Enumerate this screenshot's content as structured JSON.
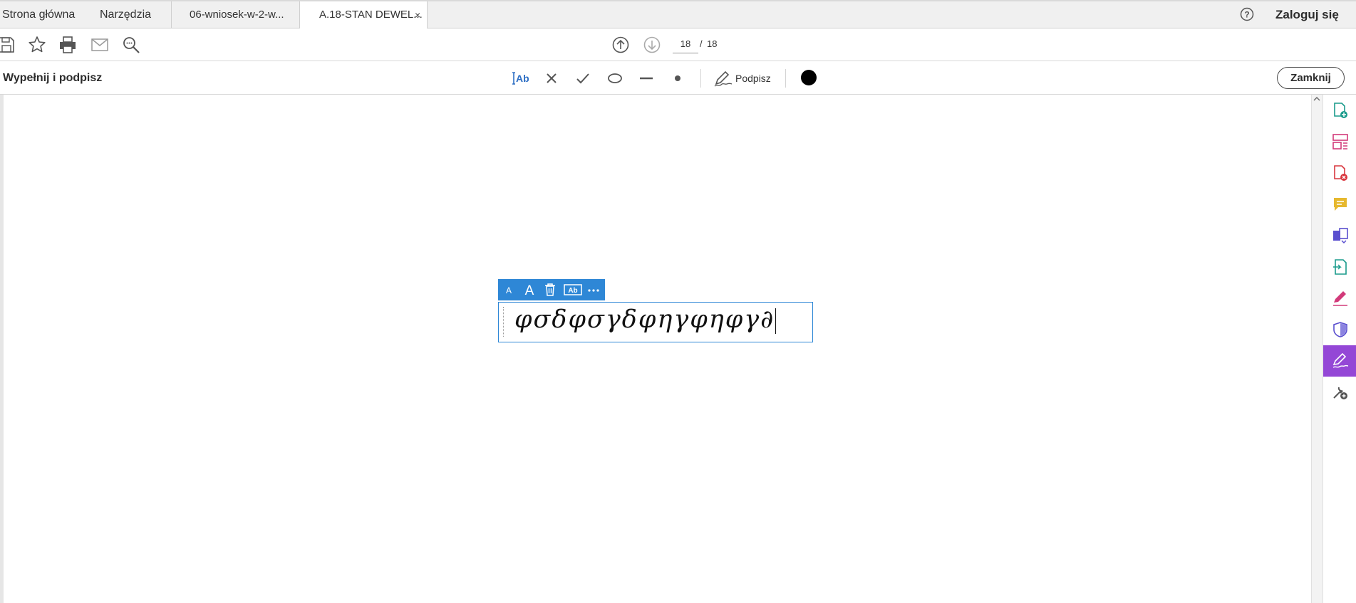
{
  "tabs": {
    "home": "Strona główna",
    "tools": "Narzędzia",
    "documents": [
      {
        "label": "06-wniosek-w-2-w...",
        "active": false
      },
      {
        "label": "A.18-STAN DEWEL...",
        "active": true,
        "close": "×"
      }
    ]
  },
  "header": {
    "login": "Zaloguj się"
  },
  "toolbar": {
    "page_current": "18",
    "page_separator": "/",
    "page_total": "18"
  },
  "fill_sign": {
    "title": "Wypełnij i podpisz",
    "sign_label": "Podpisz",
    "close_label": "Zamknij",
    "current_color": "#000000"
  },
  "text_field": {
    "value": "φσδφσγδφηγφηφγ∂"
  },
  "colors": {
    "accent": "#2e87d6",
    "panel_active": "#9447d6"
  },
  "icons": {
    "toolbar": [
      "save-icon",
      "star-icon",
      "print-icon",
      "mail-icon",
      "search-icon",
      "prev-page-icon",
      "next-page-icon"
    ],
    "fill_sign": [
      "add-text-icon",
      "cross-icon",
      "check-icon",
      "ellipse-icon",
      "line-icon",
      "dot-icon",
      "sign-icon"
    ],
    "floating": [
      "font-smaller-icon",
      "font-larger-icon",
      "delete-icon",
      "field-type-icon",
      "more-icon"
    ],
    "right_panel": [
      "create-pdf-icon",
      "organize-pages-icon",
      "export-pdf-icon",
      "comment-icon",
      "combine-files-icon",
      "send-for-signature-icon",
      "edit-sign-icon",
      "protect-icon",
      "fill-sign-icon",
      "more-tools-icon"
    ]
  }
}
